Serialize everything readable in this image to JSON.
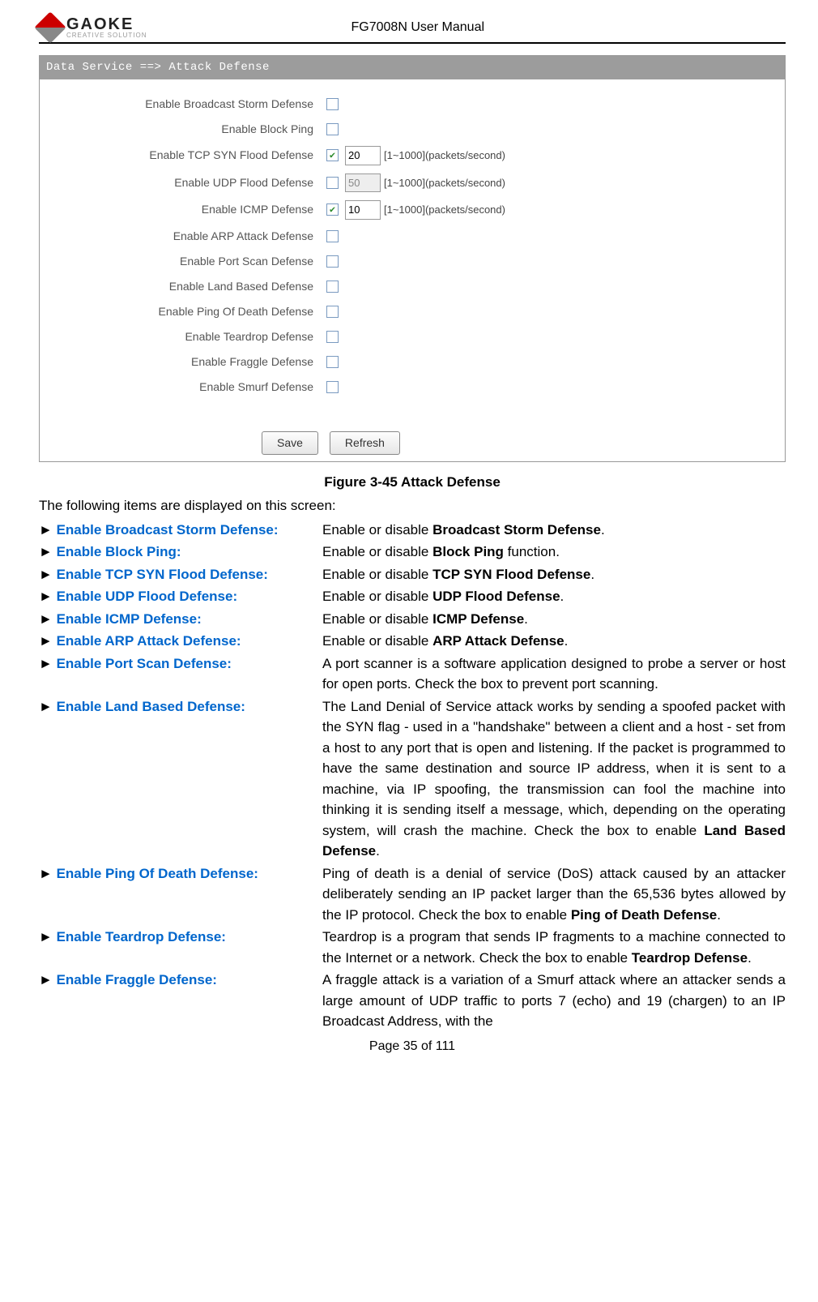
{
  "header": {
    "logo_main": "GAOKE",
    "logo_sub": "CREATIVE SOLUTION",
    "doc_title": "FG7008N User Manual"
  },
  "screenshot": {
    "breadcrumb": "Data Service ==> Attack Defense",
    "rows": [
      {
        "label": "Enable Broadcast Storm Defense",
        "checked": false
      },
      {
        "label": "Enable Block Ping",
        "checked": false
      },
      {
        "label": "Enable TCP SYN Flood Defense",
        "checked": true,
        "value": "20",
        "hint": "[1~1000](packets/second)"
      },
      {
        "label": "Enable UDP Flood Defense",
        "checked": false,
        "value": "50",
        "disabled": true,
        "hint": "[1~1000](packets/second)"
      },
      {
        "label": "Enable ICMP Defense",
        "checked": true,
        "value": "10",
        "hint": "[1~1000](packets/second)"
      },
      {
        "label": "Enable ARP Attack Defense",
        "checked": false
      },
      {
        "label": "Enable Port Scan Defense",
        "checked": false
      },
      {
        "label": "Enable Land Based Defense",
        "checked": false
      },
      {
        "label": "Enable Ping Of Death Defense",
        "checked": false
      },
      {
        "label": "Enable Teardrop Defense",
        "checked": false
      },
      {
        "label": "Enable Fraggle Defense",
        "checked": false
      },
      {
        "label": "Enable Smurf Defense",
        "checked": false
      }
    ],
    "buttons": {
      "save": "Save",
      "refresh": "Refresh"
    }
  },
  "caption": "Figure 3-45  Attack Defense",
  "intro": "The following items are displayed on this screen:",
  "defs": [
    {
      "term": "Enable Broadcast Storm Defense:",
      "desc_pre": "Enable or disable ",
      "desc_bold": "Broadcast Storm Defense",
      "desc_post": "."
    },
    {
      "term": "Enable Block Ping:",
      "desc_pre": "Enable or disable ",
      "desc_bold": "Block Ping",
      "desc_post": " function."
    },
    {
      "term": "Enable TCP SYN Flood Defense:",
      "desc_pre": "Enable or disable ",
      "desc_bold": "TCP SYN Flood Defense",
      "desc_post": "."
    },
    {
      "term": "Enable UDP Flood Defense:",
      "desc_pre": "Enable or disable ",
      "desc_bold": "UDP Flood Defense",
      "desc_post": "."
    },
    {
      "term": "Enable ICMP Defense:",
      "desc_pre": "Enable or disable ",
      "desc_bold": "ICMP Defense",
      "desc_post": "."
    },
    {
      "term": "Enable ARP Attack Defense:",
      "desc_pre": "Enable or disable ",
      "desc_bold": "ARP Attack Defense",
      "desc_post": "."
    },
    {
      "term": "Enable Port Scan Defense:",
      "desc_pre": "A port scanner is a software application designed to probe a server or host for open ports. Check the box to prevent port scanning.",
      "desc_bold": "",
      "desc_post": ""
    },
    {
      "term": "Enable Land Based Defense:",
      "desc_pre": "The Land Denial of Service attack works by sending a spoofed packet with the SYN flag - used in a \"handshake\" between a client and a host - set from a host to any port that is open and listening. If the packet is programmed to have the same destination and source IP address, when it is sent to a machine, via IP spoofing, the transmission can fool the machine into thinking it is sending itself a message, which, depending on the operating system, will crash the machine. Check the box to enable ",
      "desc_bold": "Land Based Defense",
      "desc_post": "."
    },
    {
      "term": "Enable Ping Of Death Defense:",
      "desc_pre": "Ping of death is a denial of service (DoS) attack caused by an attacker deliberately sending an IP packet larger than the 65,536 bytes allowed by the IP protocol. Check the box to enable ",
      "desc_bold": "Ping of Death Defense",
      "desc_post": "."
    },
    {
      "term": "Enable Teardrop Defense:",
      "desc_pre": "Teardrop is a program that sends IP fragments to a machine connected to the Internet or a network. Check the box to enable ",
      "desc_bold": "Teardrop Defense",
      "desc_post": "."
    },
    {
      "term": "Enable Fraggle Defense:",
      "desc_pre": "A fraggle attack is a variation of a Smurf attack where an attacker sends a large amount of UDP traffic to ports 7 (echo) and 19 (chargen) to an IP Broadcast Address, with the",
      "desc_bold": "",
      "desc_post": ""
    }
  ],
  "footer": "Page 35 of 111"
}
